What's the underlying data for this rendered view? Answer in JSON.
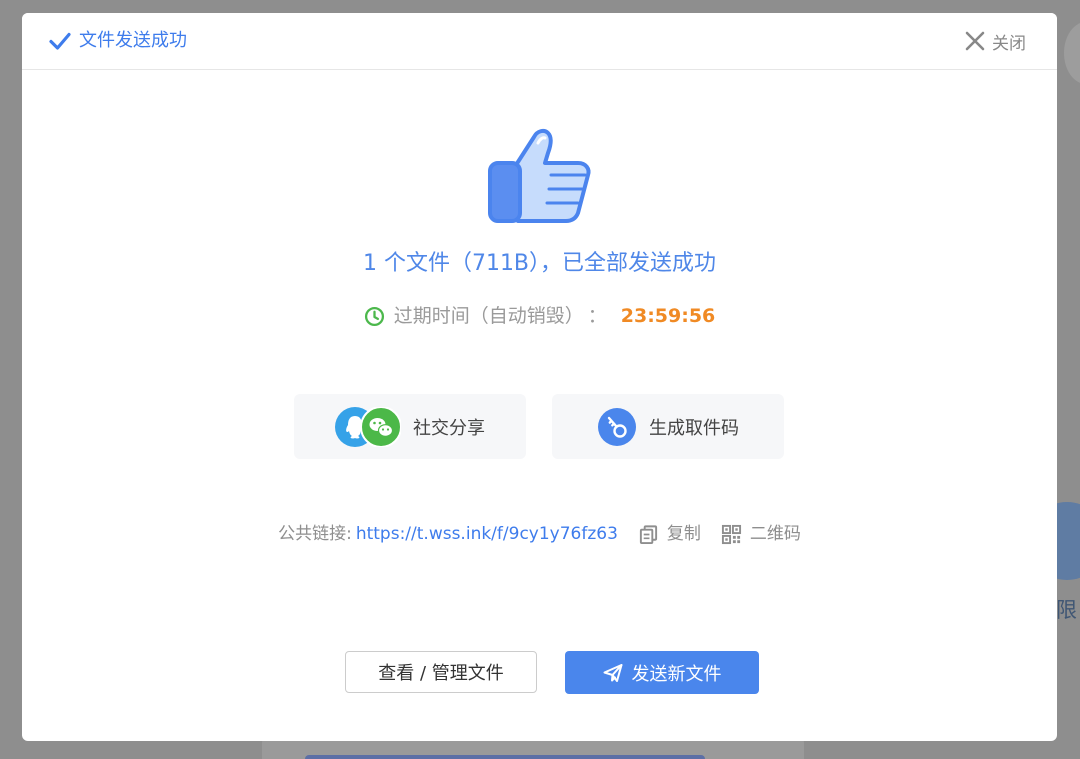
{
  "dialog": {
    "title": "文件发送成功",
    "close_label": "关闭"
  },
  "result": {
    "message": "1 个文件（711B），已全部发送成功",
    "expire_label": "过期时间（自动销毁）",
    "expire_sep": "：",
    "expire_time": "23:59:56"
  },
  "actions": {
    "social_share_label": "社交分享",
    "pickup_code_label": "生成取件码"
  },
  "link": {
    "label": "公共链接:",
    "url": "https://t.wss.ink/f/9cy1y76fz63",
    "copy_label": "复制",
    "qrcode_label": "二维码"
  },
  "buttons": {
    "manage_label": "查看 / 管理文件",
    "send_new_label": "发送新文件"
  },
  "background": {
    "side_text": "限"
  },
  "colors": {
    "accent": "#3e7cec",
    "primary_button": "#4a86ec",
    "timer": "#f08a24",
    "clock": "#4cb84c",
    "wechat": "#4cb848",
    "qq": "#36a2e8"
  },
  "icons": {
    "header": "check-icon",
    "close": "close-icon",
    "hero": "thumbs-up-icon",
    "expire": "clock-icon",
    "social": [
      "qq-icon",
      "wechat-icon"
    ],
    "pickup": "key-icon",
    "copy": "copy-icon",
    "qrcode": "qrcode-icon",
    "send": "paper-plane-icon"
  }
}
